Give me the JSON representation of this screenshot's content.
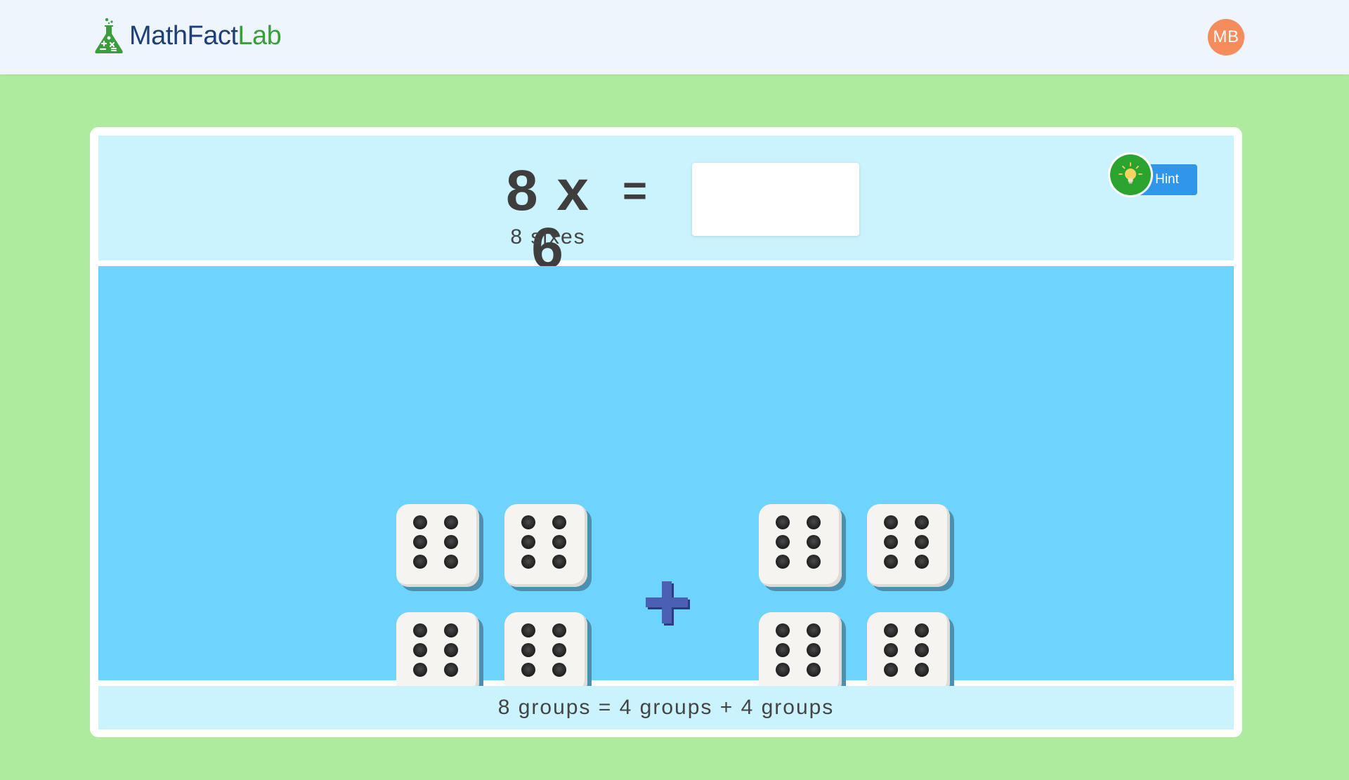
{
  "header": {
    "logo_main": "MathFact",
    "logo_accent": "Lab",
    "avatar_initials": "MB",
    "logo_icon": "flask-icon"
  },
  "problem": {
    "expression": "8 x 6",
    "equals": "=",
    "subtitle": "8 sixes",
    "answer_value": "",
    "answer_placeholder": ""
  },
  "hint": {
    "label": "Hint",
    "icon": "lightbulb-icon"
  },
  "model": {
    "left_group_count": 4,
    "right_group_count": 4,
    "die_face_value": 6,
    "operator_icon": "plus-icon"
  },
  "statement": "8 groups = 4 groups + 4 groups",
  "colors": {
    "background": "#aeeb9e",
    "header": "#eff5fd",
    "problem_panel": "#cbf3fd",
    "model_panel": "#6fd4fd",
    "hint_button": "#2f96ea",
    "hint_bulb": "#2aa32f",
    "avatar": "#f58c5c",
    "plus": "#3f55a8"
  }
}
